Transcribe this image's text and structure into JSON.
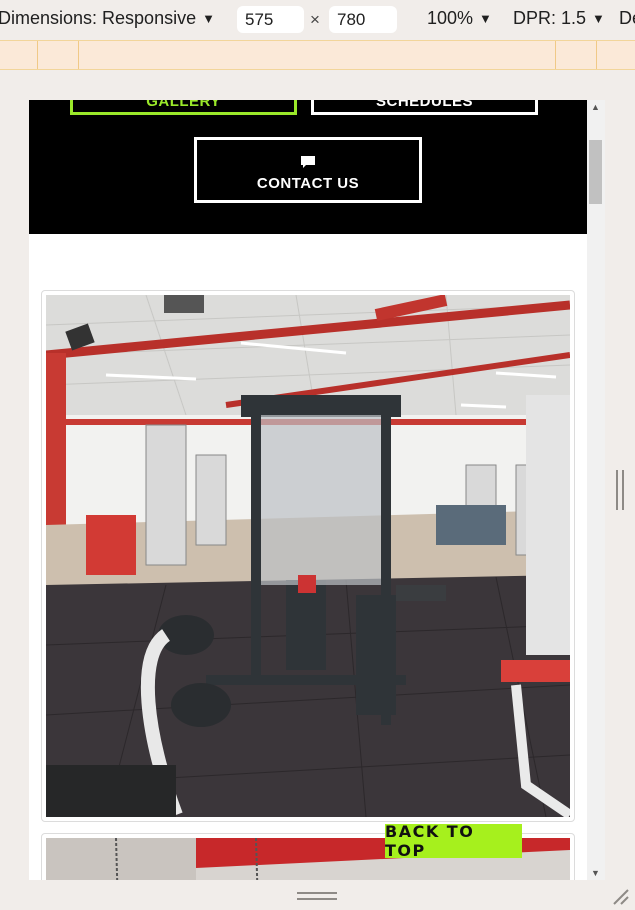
{
  "toolbar": {
    "dimensions_label": "Dimensions: Responsive",
    "width_value": "575",
    "times_symbol": "×",
    "height_value": "780",
    "zoom_label": "100%",
    "dpr_label": "DPR: 1.5",
    "truncated_label": "De"
  },
  "page": {
    "gallery_label": "GALLERY",
    "schedules_label": "SCHEDULES",
    "contact_label": "CONTACT US",
    "back_to_top_label": "BACK TO TOP"
  },
  "icons": {
    "caret": "caret-down-icon",
    "chat": "chat-bubble-icon",
    "scroll_up": "scroll-up-arrow-icon",
    "scroll_down": "scroll-down-arrow-icon"
  },
  "colors": {
    "accent_green": "#a6f01d",
    "gallery_border": "#9ae82a",
    "black_section": "#000000",
    "media_query_bar": "#fbe9d8"
  }
}
